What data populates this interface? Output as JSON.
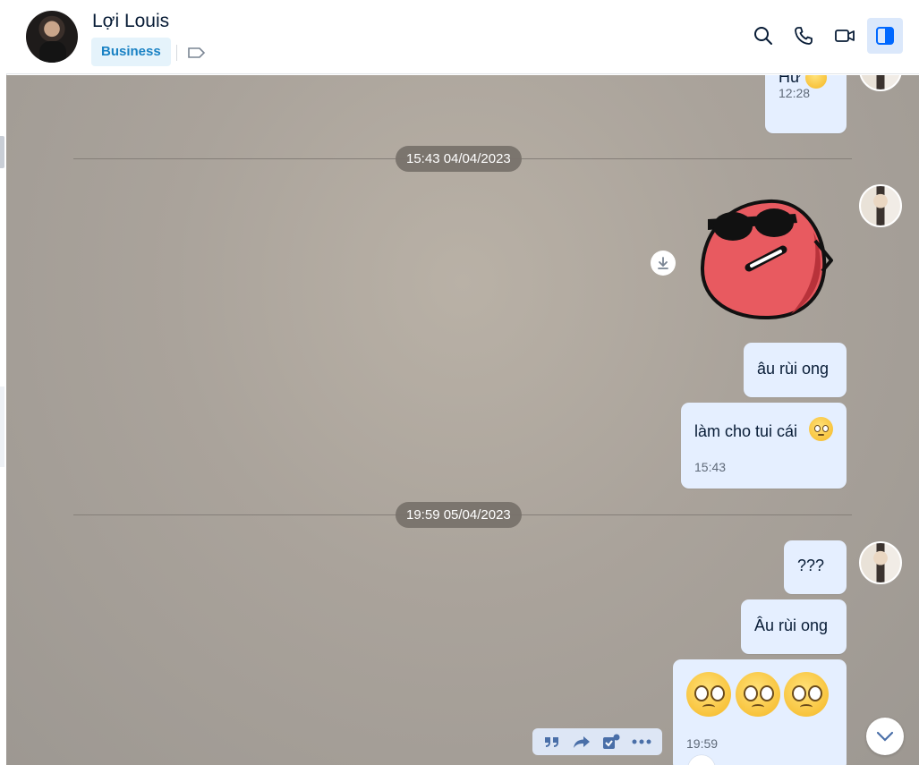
{
  "contact": {
    "name": "Lợi Louis",
    "badge": "Business"
  },
  "header_actions": [
    "search-icon",
    "phone-icon",
    "video-icon",
    "sidebar-toggle-icon"
  ],
  "colors": {
    "accent": "#0068ff",
    "bubble": "#e5efff",
    "badge_bg": "#e5f3fb",
    "badge_text": "#1a82c4"
  },
  "messages": {
    "top": {
      "text": "Hư",
      "time": "12:28"
    },
    "date1": "15:43 04/04/2023",
    "m1": {
      "text": "âu rùi ong"
    },
    "m2": {
      "text": "làm cho tui cái",
      "time": "15:43"
    },
    "date2": "19:59 05/04/2023",
    "m3": {
      "text": "???"
    },
    "m4": {
      "text": "Âu rùi ong"
    },
    "m5": {
      "time": "19:59"
    }
  },
  "message_actions": [
    "quote-icon",
    "forward-icon",
    "task-icon",
    "more-icon"
  ]
}
